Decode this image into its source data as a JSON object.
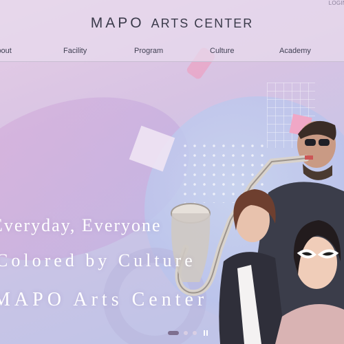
{
  "header": {
    "login_label": "LOGIN",
    "logo": {
      "primary": "MAPO",
      "secondary": "ARTS CENTER"
    }
  },
  "nav": {
    "items": [
      {
        "label": "About"
      },
      {
        "label": "Facility"
      },
      {
        "label": "Program"
      },
      {
        "label": "Culture"
      },
      {
        "label": "Academy"
      }
    ]
  },
  "hero": {
    "lines": [
      "Everyday, Everyone",
      "Colored by Culture",
      "MAPO Arts Center"
    ]
  },
  "slider": {
    "slide_count": 3,
    "active_index": 0,
    "control_icon": "pause-icon"
  },
  "colors": {
    "accent": "#7e6f8f",
    "nav_text": "#3f3f52",
    "hero_text": "#ffffff",
    "background": "#d7c3e3"
  }
}
